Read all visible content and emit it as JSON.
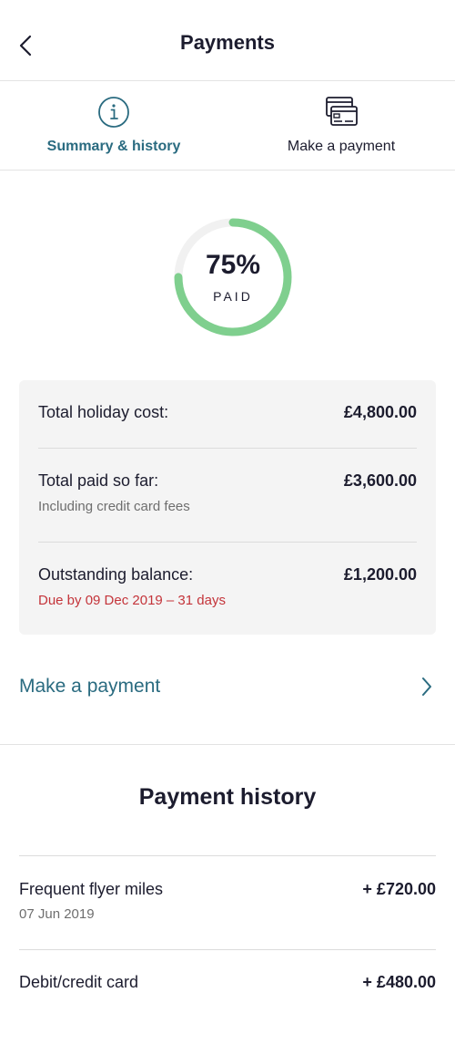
{
  "header": {
    "title": "Payments",
    "back_icon": "chevron-left-icon"
  },
  "tabs": [
    {
      "label": "Summary & history",
      "icon": "info-icon",
      "active": true
    },
    {
      "label": "Make a payment",
      "icon": "credit-cards-icon",
      "active": false
    }
  ],
  "progress": {
    "percent_text": "75%",
    "label": "PAID",
    "fraction": 0.75,
    "fill_color": "#7fcf8e",
    "track_color": "#f1f1f1"
  },
  "summary": {
    "total_cost_label": "Total holiday cost:",
    "total_cost_value": "£4,800.00",
    "paid_label": "Total paid so far:",
    "paid_value": "£3,600.00",
    "paid_note": "Including credit card fees",
    "outstanding_label": "Outstanding balance:",
    "outstanding_value": "£1,200.00",
    "due_text": "Due by 09 Dec 2019 – 31 days"
  },
  "make_payment_link": {
    "label": "Make a payment",
    "icon": "chevron-right-icon"
  },
  "history": {
    "title": "Payment history",
    "items": [
      {
        "method": "Frequent flyer miles",
        "amount": "+ £720.00",
        "date": "07 Jun 2019"
      },
      {
        "method": "Debit/credit card",
        "amount": "+ £480.00",
        "date": ""
      }
    ]
  },
  "colors": {
    "accent": "#2a6b80",
    "due_red": "#c4343a",
    "progress_green": "#7fcf8e"
  }
}
